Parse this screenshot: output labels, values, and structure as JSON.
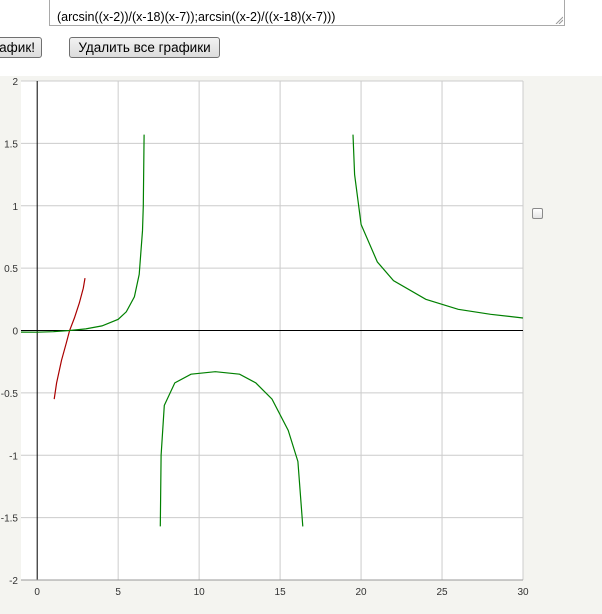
{
  "formula": {
    "value": "(arcsin((x-2))/(x-18)(x-7));arcsin((x-2)/((x-18)(x-7)))"
  },
  "toolbar": {
    "plot_label": "афик!",
    "delete_label": "Удалить все графики"
  },
  "series_toggle": {
    "checked": false
  },
  "colors": {
    "series_1": "#aa0000",
    "series_2": "#008000",
    "axis": "#000000",
    "grid": "#cccccc",
    "chart_bg": "#ffffff"
  },
  "chart_data": {
    "type": "line",
    "title": "",
    "xlabel": "",
    "ylabel": "",
    "xlim": [
      -1,
      30
    ],
    "ylim": [
      -2,
      2
    ],
    "grid": true,
    "x_ticks": [
      "0",
      "5",
      "10",
      "15",
      "20",
      "25",
      "30"
    ],
    "y_ticks": [
      "2",
      "1.5",
      "1",
      "0.5",
      "0",
      "-0.5",
      "-1",
      "-1.5",
      "-2"
    ],
    "series": [
      {
        "color": "#aa0000",
        "points": [
          [
            1.05,
            -0.55
          ],
          [
            1.2,
            -0.42
          ],
          [
            1.5,
            -0.24
          ],
          [
            1.8,
            -0.1
          ],
          [
            2.0,
            0.0
          ],
          [
            2.3,
            0.1
          ],
          [
            2.6,
            0.22
          ],
          [
            2.85,
            0.34
          ],
          [
            2.95,
            0.42
          ]
        ]
      },
      {
        "color": "#008000",
        "segments": [
          [
            [
              -1,
              -0.013
            ],
            [
              0,
              -0.014
            ],
            [
              1,
              -0.01
            ],
            [
              2,
              0.0
            ],
            [
              3,
              0.013
            ],
            [
              4,
              0.037
            ],
            [
              5,
              0.09
            ],
            [
              5.5,
              0.15
            ],
            [
              6,
              0.27
            ],
            [
              6.3,
              0.45
            ],
            [
              6.5,
              0.8
            ],
            [
              6.55,
              1.0
            ],
            [
              6.6,
              1.57
            ]
          ],
          [
            [
              7.6,
              -1.57
            ],
            [
              7.65,
              -1.0
            ],
            [
              7.85,
              -0.6
            ],
            [
              8.5,
              -0.42
            ],
            [
              9.5,
              -0.35
            ],
            [
              11,
              -0.33
            ],
            [
              12.5,
              -0.35
            ],
            [
              13.5,
              -0.42
            ],
            [
              14.5,
              -0.55
            ],
            [
              15.5,
              -0.8
            ],
            [
              16.1,
              -1.05
            ],
            [
              16.4,
              -1.57
            ]
          ],
          [
            [
              19.5,
              1.57
            ],
            [
              19.6,
              1.25
            ],
            [
              20,
              0.85
            ],
            [
              21,
              0.55
            ],
            [
              22,
              0.4
            ],
            [
              24,
              0.25
            ],
            [
              26,
              0.17
            ],
            [
              28,
              0.13
            ],
            [
              30,
              0.1
            ]
          ]
        ]
      }
    ]
  }
}
